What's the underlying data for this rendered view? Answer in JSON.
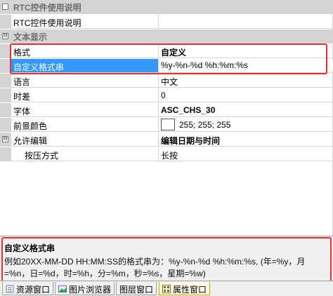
{
  "categories": {
    "rtc": {
      "toggle": "",
      "label": "RTC控件使用说明"
    },
    "text": {
      "toggle": "⊟",
      "label": "文本显示"
    }
  },
  "rows": {
    "rtc_desc": {
      "name": "RTC控件使用说明",
      "value": ""
    },
    "format": {
      "name": "格式",
      "value": "自定义"
    },
    "custom_format": {
      "name": "自定义格式串",
      "value": "%y-%n-%d %h:%m:%s"
    },
    "language": {
      "name": "语言",
      "value": "中文"
    },
    "timezone": {
      "name": "时差",
      "value": "0"
    },
    "font": {
      "name": "字体",
      "value": "ASC_CHS_30"
    },
    "fg_color": {
      "name": "前景颜色",
      "value": "255; 255; 255",
      "swatch": "#ffffff"
    },
    "allow_edit": {
      "toggle": "⊟",
      "name": "允许编辑",
      "value": "编辑日期与时间"
    },
    "press_mode": {
      "name": "按压方式",
      "value": "长按"
    }
  },
  "description": {
    "title": "自定义格式串",
    "text": "例如20XX-MM-DD HH:MM:SS的格式串为：%y-%n-%d %h:%m:%s, (年=%y，月=%n，日=%d，时=%h，分=%m，秒=%s，星期=%w)"
  },
  "tabs": [
    {
      "label": "资源窗口",
      "icon": "resource-window-icon"
    },
    {
      "label": "图片浏览器",
      "icon": "image-browser-icon"
    },
    {
      "label": "图层窗口",
      "icon": "layer-window-icon"
    },
    {
      "label": "属性窗口",
      "icon": "property-window-icon",
      "active": true
    }
  ],
  "colors": {
    "selection": "#3399ff",
    "highlight_border": "#e53030",
    "category_bg": "#d4d4d4"
  }
}
